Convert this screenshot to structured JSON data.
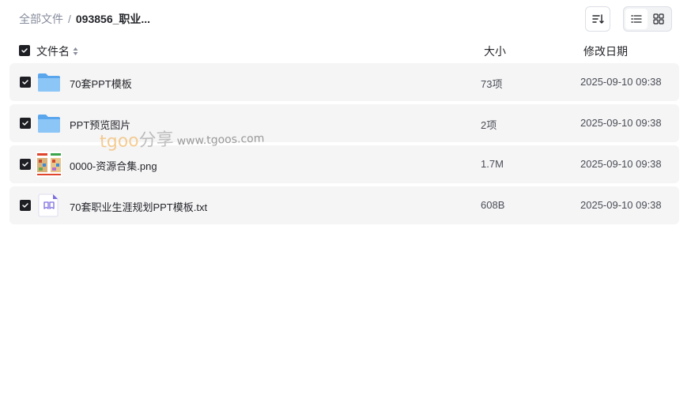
{
  "breadcrumb": {
    "root": "全部文件",
    "separator": "/",
    "current": "093856_职业..."
  },
  "toolbar": {
    "sort_icon": "sort-icon",
    "list_view_icon": "list-view-icon",
    "grid_view_icon": "grid-view-icon",
    "active_view": "list"
  },
  "columns": {
    "name": "文件名",
    "size": "大小",
    "date": "修改日期"
  },
  "files": [
    {
      "name": "70套PPT模板",
      "size": "73项",
      "date": "2025-09-10 09:38",
      "type": "folder",
      "checked": true
    },
    {
      "name": "PPT预览图片",
      "size": "2项",
      "date": "2025-09-10 09:38",
      "type": "folder",
      "checked": true
    },
    {
      "name": "0000-资源合集.png",
      "size": "1.7M",
      "date": "2025-09-10 09:38",
      "type": "image",
      "checked": true
    },
    {
      "name": "70套职业生涯规划PPT模板.txt",
      "size": "608B",
      "date": "2025-09-10 09:38",
      "type": "text",
      "checked": true
    }
  ],
  "watermark": {
    "brand_a": "tgoo",
    "brand_b": "分享",
    "url": "www.tgoos.com"
  },
  "colors": {
    "row_bg": "#f5f5f6",
    "checkbox": "#1e1f24",
    "folder": "#6fb2f2",
    "muted_text": "#878c9c"
  }
}
